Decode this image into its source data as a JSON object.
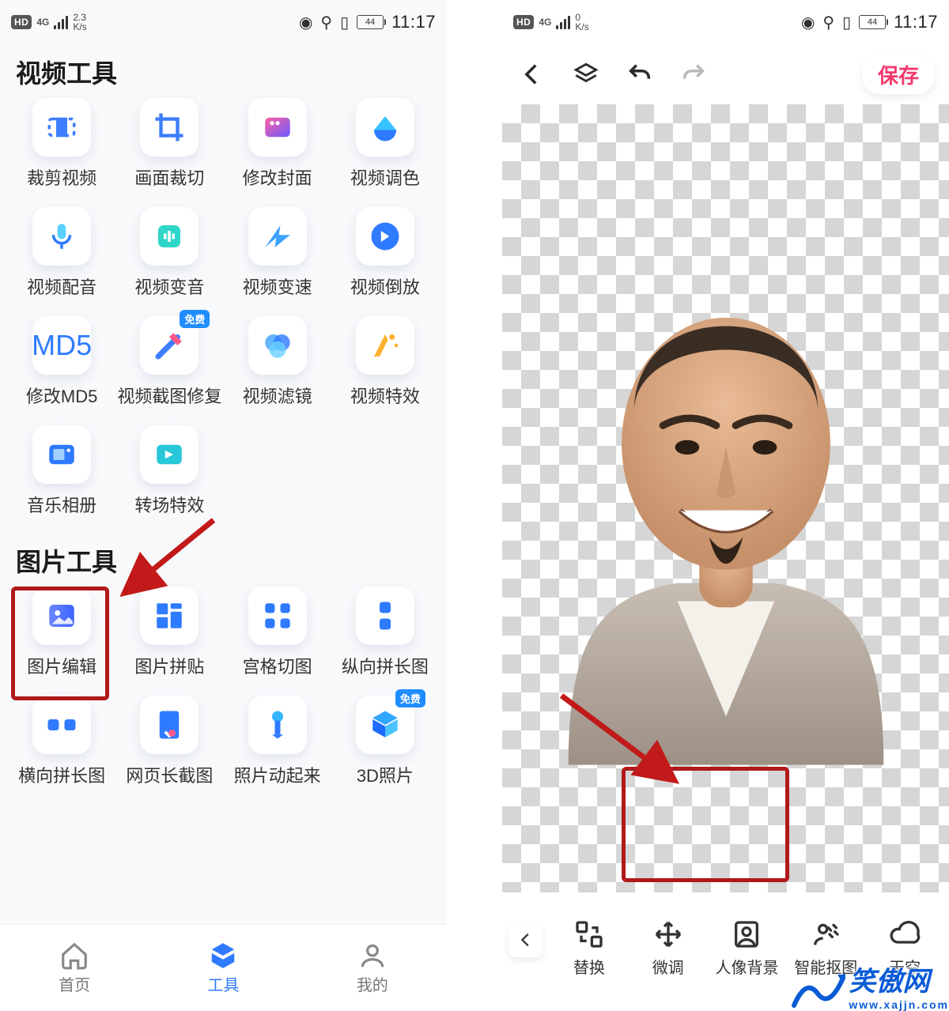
{
  "statusbar": {
    "hd": "HD",
    "net": "4G",
    "speed_left": "2.3",
    "speed_left_unit": "K/s",
    "speed_right": "0",
    "speed_right_unit": "K/s",
    "battery": "44",
    "time": "11:17"
  },
  "left": {
    "section_video": "视频工具",
    "section_image": "图片工具",
    "tools_video": [
      {
        "id": "crop-video",
        "label": "裁剪视频"
      },
      {
        "id": "frame-crop",
        "label": "画面裁切"
      },
      {
        "id": "edit-cover",
        "label": "修改封面"
      },
      {
        "id": "video-color",
        "label": "视频调色"
      },
      {
        "id": "video-dub",
        "label": "视频配音"
      },
      {
        "id": "voice-change",
        "label": "视频变音"
      },
      {
        "id": "speed",
        "label": "视频变速"
      },
      {
        "id": "reverse",
        "label": "视频倒放"
      },
      {
        "id": "md5",
        "label": "修改MD5"
      },
      {
        "id": "shot-repair",
        "label": "视频截图修复",
        "free": true
      },
      {
        "id": "filter",
        "label": "视频滤镜"
      },
      {
        "id": "vfx",
        "label": "视频特效"
      },
      {
        "id": "album",
        "label": "音乐相册"
      },
      {
        "id": "transition",
        "label": "转场特效"
      }
    ],
    "tools_image": [
      {
        "id": "img-edit",
        "label": "图片编辑"
      },
      {
        "id": "collage",
        "label": "图片拼贴"
      },
      {
        "id": "grid-cut",
        "label": "宫格切图"
      },
      {
        "id": "v-long",
        "label": "纵向拼长图"
      },
      {
        "id": "h-long",
        "label": "横向拼长图"
      },
      {
        "id": "web-long",
        "label": "网页长截图"
      },
      {
        "id": "live-photo",
        "label": "照片动起来"
      },
      {
        "id": "3d-photo",
        "label": "3D照片",
        "free": true
      }
    ],
    "nav": {
      "home": "首页",
      "tools": "工具",
      "mine": "我的"
    },
    "free_tag": "免费"
  },
  "right": {
    "save": "保存",
    "bottom": {
      "replace": "替换",
      "fine": "微调",
      "portrait": "人像背景",
      "cutout": "智能抠图",
      "sky": "天空"
    }
  },
  "watermark": {
    "main": "笑傲网",
    "sub": "www.xajjn.com"
  }
}
